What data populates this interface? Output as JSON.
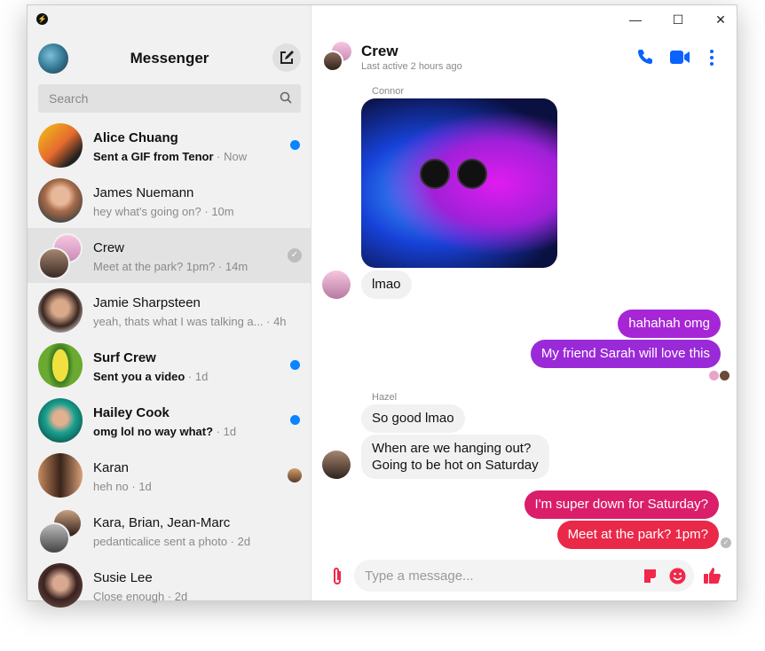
{
  "app": {
    "title": "Messenger"
  },
  "search": {
    "placeholder": "Search"
  },
  "conversations": [
    {
      "name": "Alice Chuang",
      "preview": "Sent a GIF from Tenor",
      "time": "Now",
      "unread": true
    },
    {
      "name": "James Nuemann",
      "preview": "hey what's going on?",
      "time": "10m"
    },
    {
      "name": "Crew",
      "preview": "Meet at the park? 1pm?",
      "time": "14m",
      "selected": true,
      "status": "seen-check"
    },
    {
      "name": "Jamie Sharpsteen",
      "preview": "yeah, thats what I was talking a...",
      "time": "4h"
    },
    {
      "name": "Surf Crew",
      "preview": "Sent you a video",
      "time": "1d",
      "unread": true
    },
    {
      "name": "Hailey Cook",
      "preview": "omg lol no way what?",
      "time": "1d",
      "unread": true
    },
    {
      "name": "Karan",
      "preview": "heh no",
      "time": "1d"
    },
    {
      "name": "Kara, Brian, Jean-Marc",
      "preview": "pedanticalice sent a photo",
      "time": "2d"
    },
    {
      "name": "Susie Lee",
      "preview": "Close enough",
      "time": "2d"
    }
  ],
  "header": {
    "title": "Crew",
    "subtitle": "Last active 2 hours ago"
  },
  "window": {
    "minimize": "—",
    "maximize": "☐",
    "close": "✕"
  },
  "messages": {
    "connor_name": "Connor",
    "connor_text": "lmao",
    "out1": "hahahah omg",
    "out2": "My friend Sarah will love this",
    "hazel_name": "Hazel",
    "hazel1": "So good lmao",
    "hazel2a": "When are we hanging out?",
    "hazel2b": "Going to be hot on Saturday",
    "out3": "I'm super down for Saturday?",
    "out4": "Meet at the park? 1pm?"
  },
  "composer": {
    "placeholder": "Type a message..."
  },
  "colors": {
    "accent": "#0a62ff",
    "unread_dot": "#0a84ff",
    "purple": "#a626d6",
    "pink_red": "#e8244e"
  }
}
